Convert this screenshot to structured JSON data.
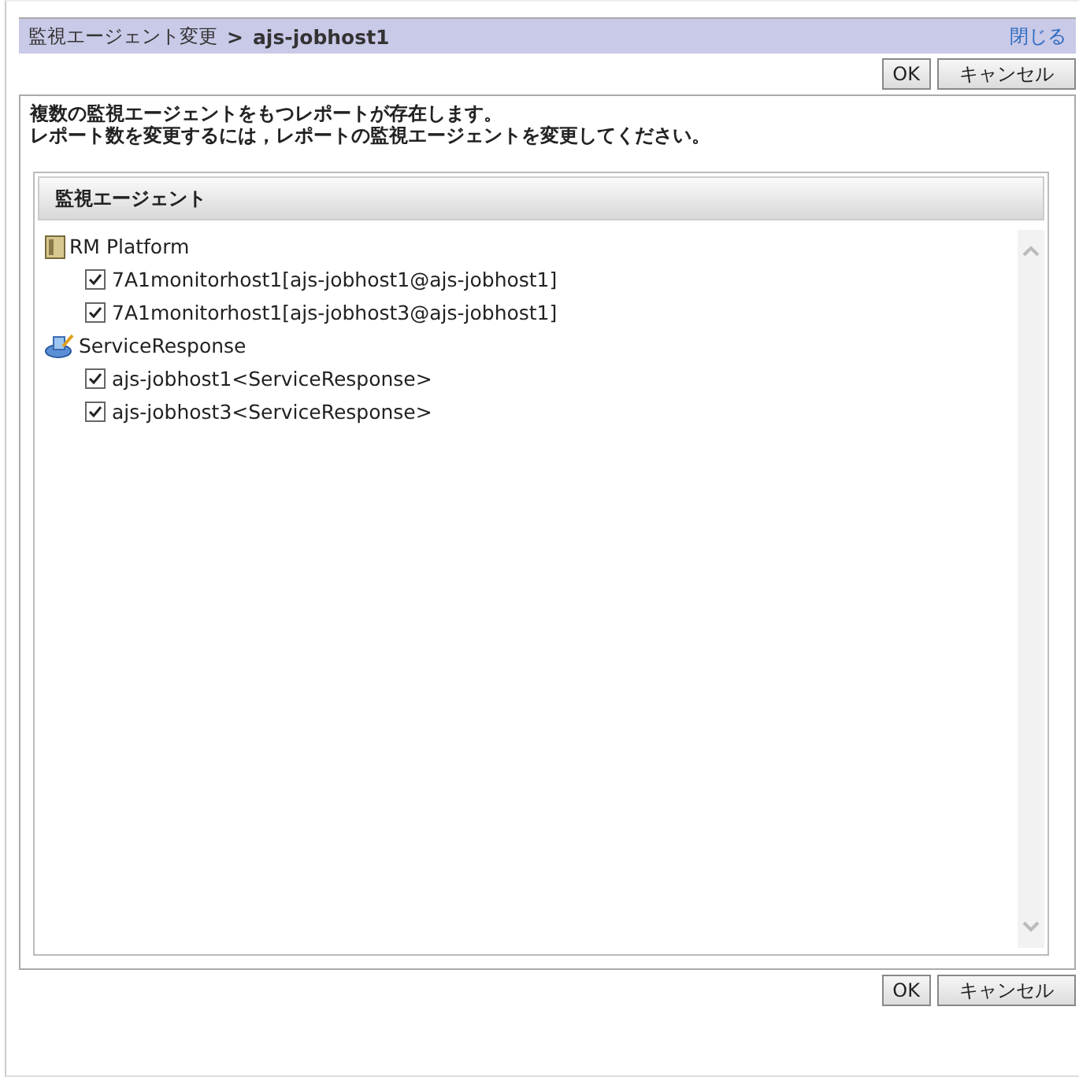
{
  "title_bar": {
    "title": "監視エージェント変更",
    "separator": ">",
    "host": "ajs-jobhost1",
    "close_link": "閉じる"
  },
  "top_buttons": [
    "OK",
    "キャンセル"
  ],
  "message": [
    "複数の監視エージェントをもつレポートが存在します。",
    "レポート数を変更するには，レポートの監視エージェントを変更してください。"
  ],
  "panel": {
    "header": "監視エージェント",
    "tree": [
      {
        "label": "RM Platform",
        "kind": "platform",
        "children": [
          {
            "label": "7A1monitorhost1[ajs-jobhost1@ajs-jobhost1]",
            "checked": true
          },
          {
            "label": "7A1monitorhost1[ajs-jobhost3@ajs-jobhost1]",
            "checked": true
          }
        ]
      },
      {
        "label": "ServiceResponse",
        "kind": "service",
        "children": [
          {
            "label": "ajs-jobhost1<ServiceResponse>",
            "checked": true
          },
          {
            "label": "ajs-jobhost3<ServiceResponse>",
            "checked": true
          }
        ]
      }
    ]
  },
  "bottom_buttons": [
    "OK",
    "キャンセル"
  ]
}
